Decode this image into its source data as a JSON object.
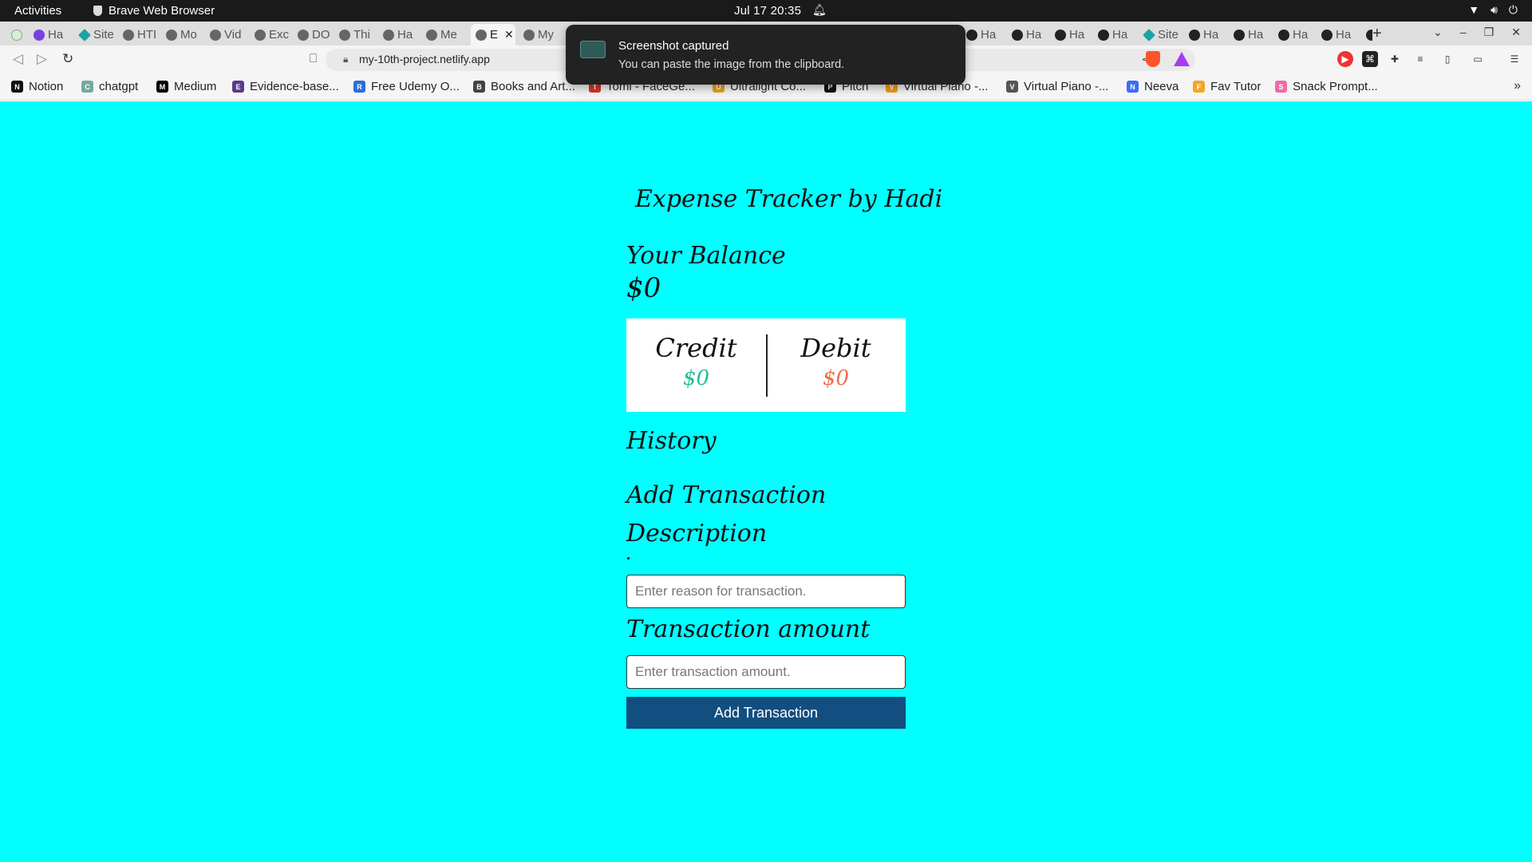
{
  "system_bar": {
    "activities": "Activities",
    "app_name": "Brave Web Browser",
    "clock": "Jul 17  20:35"
  },
  "tabs": [
    {
      "label": "",
      "icon": "gray"
    },
    {
      "label": "Ha",
      "icon": "purple"
    },
    {
      "label": "Site",
      "icon": "diamond"
    },
    {
      "label": "HTI",
      "icon": "globe"
    },
    {
      "label": "Mo",
      "icon": "globe"
    },
    {
      "label": "Vid",
      "icon": "globe"
    },
    {
      "label": "Exc",
      "icon": "globe"
    },
    {
      "label": "DO",
      "icon": "globe"
    },
    {
      "label": "Thi",
      "icon": "globe"
    },
    {
      "label": "Ha",
      "icon": "globe"
    },
    {
      "label": "Me",
      "icon": "globe"
    },
    {
      "label": "E",
      "icon": "globe",
      "active": true
    },
    {
      "label": "My",
      "icon": "globe"
    },
    {
      "label": "Ha",
      "icon": "github"
    },
    {
      "label": "Ha",
      "icon": "github"
    },
    {
      "label": "Ha",
      "icon": "github"
    },
    {
      "label": "Ha",
      "icon": "github"
    },
    {
      "label": "Site",
      "icon": "diamond"
    },
    {
      "label": "Ha",
      "icon": "github"
    },
    {
      "label": "Ha",
      "icon": "github"
    },
    {
      "label": "Ha",
      "icon": "github"
    },
    {
      "label": "Ha",
      "icon": "github"
    },
    {
      "label": "Ha",
      "icon": "github"
    }
  ],
  "address_bar": {
    "url": "my-10th-project.netlify.app"
  },
  "bookmarks": [
    {
      "label": "Notion",
      "icon_color": "#111111",
      "glyph": "N"
    },
    {
      "label": "chatgpt",
      "icon_color": "#74aa9c",
      "glyph": "C"
    },
    {
      "label": "Medium",
      "icon_color": "#000000",
      "glyph": "M"
    },
    {
      "label": "Evidence-base...",
      "icon_color": "#5b3a8c",
      "glyph": "E"
    },
    {
      "label": "Free Udemy O...",
      "icon_color": "#2a6fdb",
      "glyph": "R"
    },
    {
      "label": "Books and Art...",
      "icon_color": "#444444",
      "glyph": "B"
    },
    {
      "label": "Tomi - FaceGe...",
      "icon_color": "#d9362b",
      "glyph": "T"
    },
    {
      "label": "Ultralight Co...",
      "icon_color": "#e8a317",
      "glyph": "U"
    },
    {
      "label": "Pitch",
      "icon_color": "#111111",
      "glyph": "P"
    },
    {
      "label": "Virtual Piano -...",
      "icon_color": "#f59b1a",
      "glyph": "V"
    },
    {
      "label": "Virtual Piano -...",
      "icon_color": "#555555",
      "glyph": "V"
    },
    {
      "label": "Neeva",
      "icon_color": "#3b6cf5",
      "glyph": "N"
    },
    {
      "label": "Fav Tutor",
      "icon_color": "#f5a623",
      "glyph": "F"
    },
    {
      "label": "Snack Prompt...",
      "icon_color": "#f06aa8",
      "glyph": "S"
    }
  ],
  "notification": {
    "title": "Screenshot captured",
    "body": "You can paste the image from the clipboard."
  },
  "app": {
    "title": "Expense Tracker by Hadi",
    "balance_label": "Your Balance",
    "balance_value": "$0",
    "credit_label": "Credit",
    "credit_value": "$0",
    "debit_label": "Debit",
    "debit_value": "$0",
    "history_label": "History",
    "add_transaction_heading": "Add Transaction",
    "description_label": "Description",
    "description_placeholder": "Enter reason for transaction.",
    "amount_label": "Transaction amount",
    "amount_placeholder": "Enter transaction amount.",
    "add_button": "Add Transaction"
  },
  "colors": {
    "page_background": "#00ffff",
    "credit": "#1fbf97",
    "debit": "#f26a4b",
    "button": "#124e80"
  }
}
